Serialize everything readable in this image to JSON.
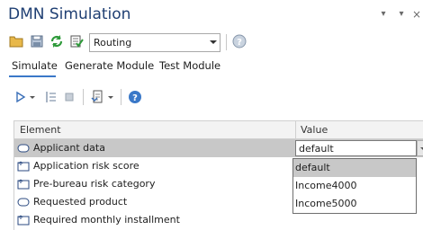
{
  "window": {
    "title": "DMN Simulation",
    "controls": {
      "pin": "▾",
      "close": "×"
    }
  },
  "toolbar": {
    "icons": [
      "folder-open-icon",
      "save-icon",
      "refresh-icon",
      "validate-icon",
      "help-icon"
    ],
    "combo": {
      "value": "Routing"
    }
  },
  "tabs": [
    {
      "label": "Simulate",
      "active": true
    },
    {
      "label": "Generate Module",
      "active": false
    },
    {
      "label": "Test Module",
      "active": false
    }
  ],
  "sim_toolbar": {
    "icons": [
      "run-icon",
      "step-icon",
      "stop-icon",
      "export-icon",
      "help-icon"
    ]
  },
  "grid": {
    "columns": [
      "Element",
      "Value"
    ],
    "rows": [
      {
        "label": "Applicant data",
        "icon": "input-data-icon",
        "value": "default",
        "selected": true
      },
      {
        "label": "Application risk score",
        "icon": "decision-icon",
        "value": ""
      },
      {
        "label": "Pre-bureau risk category",
        "icon": "decision-icon",
        "value": ""
      },
      {
        "label": "Requested product",
        "icon": "input-data-icon",
        "value": ""
      },
      {
        "label": "Required monthly installment",
        "icon": "decision-icon",
        "value": ""
      }
    ]
  },
  "dropdown": {
    "options": [
      "default",
      "Income4000",
      "Income5000"
    ],
    "selected": "default"
  },
  "colors": {
    "title": "#1f3f73",
    "accent": "#3a78c8",
    "selection": "#c8c8c8"
  }
}
